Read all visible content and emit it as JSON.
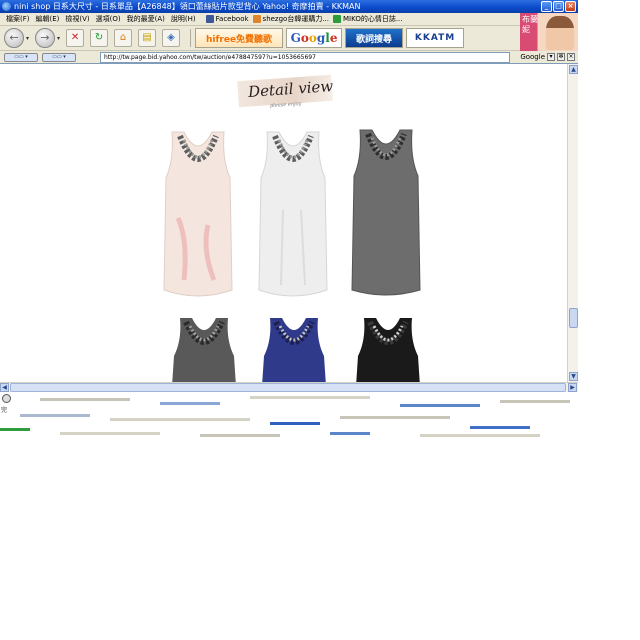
{
  "window": {
    "title": "nini shop 日系大尺寸 - 日系單品【A26848】領口蕾絲貼片款型背心 Yahoo! 奇摩拍賣 - KKMAN",
    "controls": {
      "minimize": "_",
      "maximize": "□",
      "close": "×"
    }
  },
  "menu": {
    "items": [
      "檔案(F)",
      "編輯(E)",
      "檢視(V)",
      "選項(O)",
      "我的最愛(A)",
      "說明(H)"
    ],
    "links": [
      {
        "label": "Facebook",
        "color": "#3b5998"
      },
      {
        "label": "shezgo台韓運購力...",
        "color": "#e0842a"
      },
      {
        "label": "MIKO的心情日誌...",
        "color": "#2a9d3a"
      }
    ]
  },
  "toolbar": {
    "back_icon": "back-arrow-icon",
    "forward_icon": "forward-arrow-icon",
    "promos": {
      "hifree": "hifree免費聽歌",
      "google": [
        "G",
        "o",
        "o",
        "g",
        "l",
        "e"
      ],
      "search": "歌詞搜尋",
      "kkatm": "KKATM"
    },
    "side_ad_text": "布蘭妮"
  },
  "addressbar": {
    "left_buttons": [
      "▭▭ ▾",
      "▭▭ ▾"
    ],
    "url": "http://tw.page.bid.yahoo.com/tw/auction/e478847597?u=1053665697",
    "search_engine": "Google"
  },
  "content": {
    "badge_title": "Detail view",
    "badge_subtitle": "please enjoy"
  },
  "status": {
    "text": "完"
  },
  "colors": {
    "titlebar": "#0a49c9",
    "chrome": "#ece9d8",
    "garment_blush": "#f2e3dc",
    "garment_white": "#eeeeee",
    "garment_gray": "#6d6d6d",
    "garment_navy": "#2f3b8a",
    "garment_black": "#1a1a1a"
  }
}
